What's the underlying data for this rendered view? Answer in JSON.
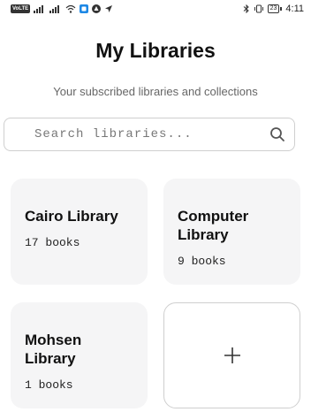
{
  "status_bar": {
    "volte_label": "VoLTE",
    "network_label": "4G",
    "battery_level": "23",
    "time": "4:11"
  },
  "header": {
    "title": "My Libraries",
    "subtitle": "Your subscribed libraries and collections"
  },
  "search": {
    "placeholder": "Search libraries...",
    "value": ""
  },
  "libraries": [
    {
      "name": "Cairo Library",
      "count_label": "17 books"
    },
    {
      "name": "Computer Library",
      "count_label": "9 books"
    },
    {
      "name": "Mohsen Library",
      "count_label": "1 books"
    }
  ],
  "add_card": {
    "icon": "plus-icon"
  },
  "colors": {
    "card_background": "#f5f5f6",
    "border": "#cfcfcf",
    "text_primary": "#111111",
    "text_secondary": "#666666"
  }
}
